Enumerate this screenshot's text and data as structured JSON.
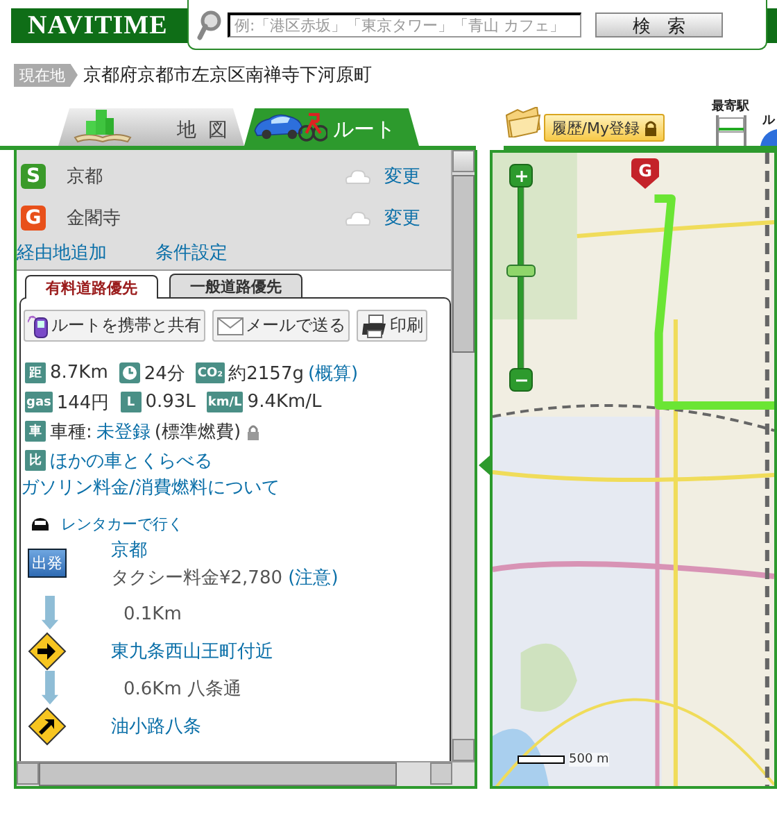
{
  "logo": "NAVITIME",
  "search": {
    "placeholder": "例:「港区赤坂」「東京タワー」「青山 カフェ」",
    "button": "検索"
  },
  "location": {
    "label": "現在地",
    "address": "京都府京都市左京区南禅寺下河原町"
  },
  "tabs": [
    {
      "kind": "map",
      "label": "地 図",
      "selected": false
    },
    {
      "kind": "route",
      "label": "ルート",
      "selected": true
    }
  ],
  "history_button": "履歴/My登録",
  "nearby": [
    {
      "kind": "station",
      "label": "最寄駅"
    },
    {
      "kind": "route",
      "label": "ル"
    }
  ],
  "route": {
    "points": [
      {
        "kind": "start",
        "mark": "S",
        "name": "京都",
        "action": "変更"
      },
      {
        "kind": "goal",
        "mark": "G",
        "name": "金閣寺",
        "action": "変更"
      }
    ],
    "links": [
      "経由地追加",
      "条件設定"
    ],
    "subtabs": [
      {
        "label": "有料道路優先",
        "selected": true
      },
      {
        "label": "一般道路優先",
        "selected": false
      }
    ],
    "actions": [
      {
        "kind": "phone",
        "label": "ルートを携帯と共有"
      },
      {
        "kind": "mail",
        "label": "メールで送る"
      },
      {
        "kind": "print",
        "label": "印刷"
      }
    ],
    "stats": [
      [
        {
          "kind": "badge",
          "badge": "距",
          "value": "8.7Km"
        },
        {
          "kind": "clock",
          "value": "24分"
        },
        {
          "kind": "badge",
          "badge": "CO₂",
          "value": "約2157g",
          "link": "(概算)"
        }
      ],
      [
        {
          "kind": "badge",
          "badge": "gas",
          "value": "144円"
        },
        {
          "kind": "badge",
          "badge": "L",
          "value": "0.93L"
        },
        {
          "kind": "badge",
          "badge": "km/L",
          "value": "9.4Km/L"
        }
      ],
      [
        {
          "kind": "badge",
          "badge": "車",
          "value": "車種:",
          "link": "未登録",
          "after": "(標準燃費)",
          "locked": true
        }
      ],
      [
        {
          "kind": "badge",
          "badge": "比",
          "link": "ほかの車とくらべる"
        }
      ]
    ],
    "fuel_link": "ガソリン料金/消費燃料について",
    "rental_link": "レンタカーで行く",
    "steps": [
      {
        "kind": "start",
        "badge": "出発",
        "name": "京都",
        "detail": "タクシー料金¥2,780 ",
        "note": "(注意)"
      },
      {
        "kind": "segment",
        "text": "0.1Km"
      },
      {
        "kind": "right",
        "name": "東九条西山王町付近"
      },
      {
        "kind": "segment",
        "text": "0.6Km 八条通"
      },
      {
        "kind": "up-right",
        "name": "油小路八条"
      }
    ]
  },
  "map": {
    "goal_marker": "G",
    "zoom": {
      "level": 0.54
    },
    "scale": "500 m"
  }
}
